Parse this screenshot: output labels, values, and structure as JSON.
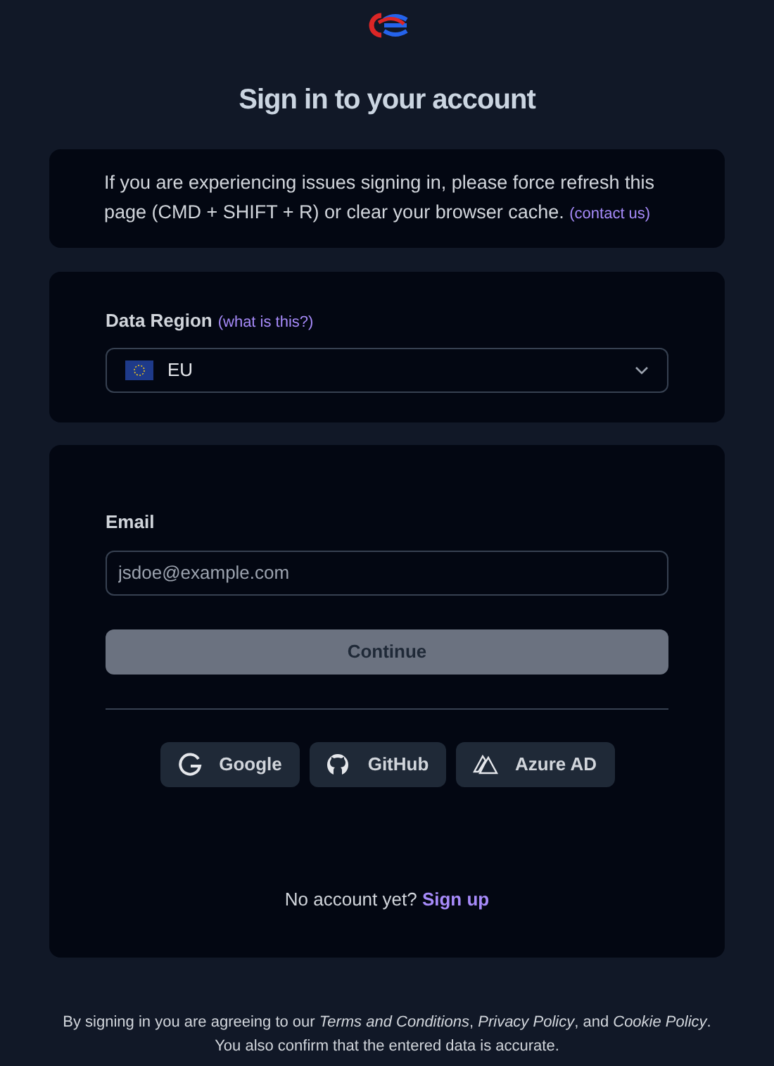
{
  "title": "Sign in to your account",
  "notice": {
    "text": "If you are experiencing issues signing in, please force refresh this page (CMD + SHIFT + R) or clear your browser cache.",
    "link": "(contact us)"
  },
  "region": {
    "label": "Data Region",
    "help_link": "(what is this?)",
    "value": "EU"
  },
  "email": {
    "label": "Email",
    "placeholder": "jsdoe@example.com"
  },
  "continue_button": {
    "label": "Continue",
    "disabled": true
  },
  "providers": [
    {
      "kind": "google",
      "label": "Google"
    },
    {
      "kind": "github",
      "label": "GitHub"
    },
    {
      "kind": "azure",
      "label": "Azure AD"
    }
  ],
  "signup": {
    "text": "No account yet?",
    "link": "Sign up"
  },
  "footer": [
    "By signing in you are agreeing to our *Terms and Conditions*, *Privacy Policy*, and *Cookie Policy*.",
    "You also confirm that the entered data is accurate."
  ]
}
